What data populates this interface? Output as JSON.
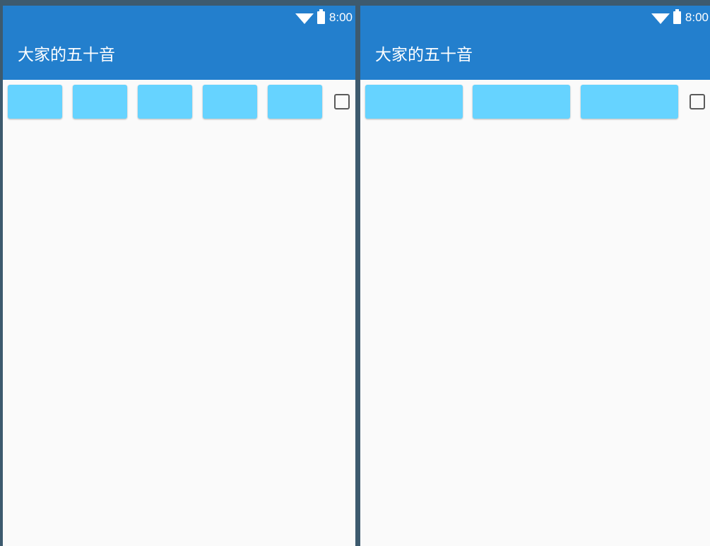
{
  "colors": {
    "primary": "#237fcd",
    "button": "#66d3ff",
    "background": "#fafafa",
    "frame": "#3d5a6e"
  },
  "screens": [
    {
      "status_bar": {
        "time": "8:00",
        "icons": [
          "wifi-icon",
          "battery-icon"
        ]
      },
      "app_bar": {
        "title": "大家的五十音"
      },
      "buttons": [
        {
          "label": ""
        },
        {
          "label": ""
        },
        {
          "label": ""
        },
        {
          "label": ""
        },
        {
          "label": ""
        }
      ],
      "checkbox": {
        "checked": false
      }
    },
    {
      "status_bar": {
        "time": "8:00",
        "icons": [
          "wifi-icon",
          "battery-icon"
        ]
      },
      "app_bar": {
        "title": "大家的五十音"
      },
      "buttons": [
        {
          "label": ""
        },
        {
          "label": ""
        },
        {
          "label": ""
        }
      ],
      "checkbox": {
        "checked": false
      }
    }
  ]
}
